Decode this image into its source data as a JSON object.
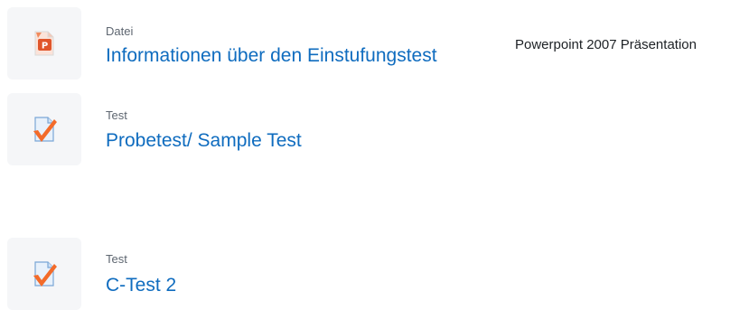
{
  "activities": [
    {
      "type": "Datei",
      "name": "Informationen über den Einstufungstest",
      "details": "Powerpoint 2007 Präsentation",
      "icon": "powerpoint-icon"
    },
    {
      "type": "Test",
      "name": "Probetest/ Sample Test",
      "icon": "quiz-icon"
    },
    {
      "type": "Test",
      "name": "C-Test 2",
      "icon": "quiz-icon"
    }
  ],
  "colors": {
    "link": "#0f6cbf",
    "icon_background": "#f5f6f8",
    "quiz_check": "#f36b2a",
    "powerpoint": "#e0562b"
  }
}
